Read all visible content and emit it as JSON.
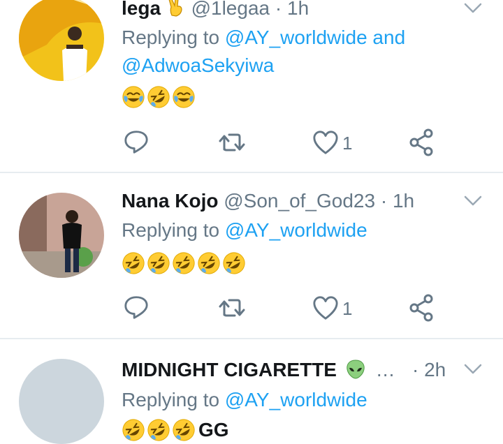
{
  "tweets": [
    {
      "name": "lega",
      "handle": "@1legaa",
      "separator": "·",
      "time": "1h",
      "replying_prefix": "Replying to",
      "mention1": "@AY_worldwide",
      "conjunction": "and",
      "mention2": "@AdwoaSekyiwa",
      "emojis": [
        "joy",
        "rofl",
        "joy"
      ],
      "like_count": "1",
      "avatar_bg": "#f2c21a"
    },
    {
      "name": "Nana Kojo",
      "handle": "@Son_of_God23",
      "separator": "·",
      "time": "1h",
      "replying_prefix": "Replying to",
      "mention1": "@AY_worldwide",
      "emojis": [
        "rofl",
        "rofl",
        "rofl",
        "rofl",
        "rofl"
      ],
      "like_count": "1",
      "avatar_bg": "#c9a79a"
    },
    {
      "name": "MIDNIGHT CIGARETTE",
      "name_suffix": "…",
      "separator": "·",
      "time": "2h",
      "replying_prefix": "Replying to",
      "mention1": "@AY_worldwide",
      "emojis": [
        "rofl",
        "rofl",
        "rofl"
      ],
      "trailing_text": "GG",
      "avatar_bg": "#ccd6dd"
    }
  ],
  "icons": {
    "reply": "reply-icon",
    "retweet": "retweet-icon",
    "like": "heart-icon",
    "share": "share-icon",
    "menu": "chevron-down-icon",
    "emoji_badge": "alien-emoji",
    "hand_emoji": "victory-hand-emoji"
  },
  "colors": {
    "name": "#14171a",
    "secondary": "#657786",
    "mention": "#1da1f2",
    "divider": "#e6ecf0",
    "emoji_yellow": "#ffcc33"
  }
}
